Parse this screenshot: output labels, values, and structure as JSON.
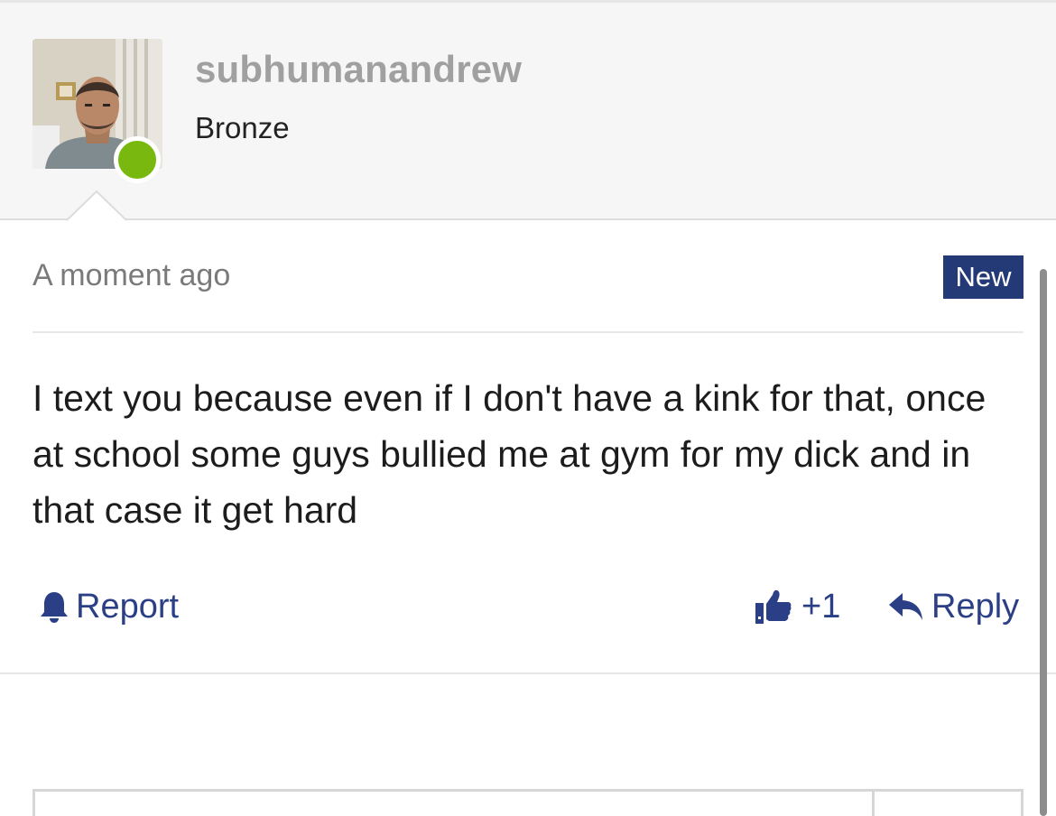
{
  "user": {
    "username": "subhumanandrew",
    "rank": "Bronze",
    "online": true,
    "online_color": "#79b80e"
  },
  "comment": {
    "timestamp": "A moment ago",
    "badge": "New",
    "badge_color": "#243a77",
    "text": "I text you because even if I don't have a kink for that, once at school some guys bullied me at gym for my dick and in that case it get hard"
  },
  "actions": {
    "report_label": "Report",
    "like_count": "+1",
    "reply_label": "Reply",
    "accent_color": "#2b3f86"
  },
  "icons": {
    "report": "bell-icon",
    "like": "thumbs-up-icon",
    "reply": "reply-arrow-icon"
  }
}
